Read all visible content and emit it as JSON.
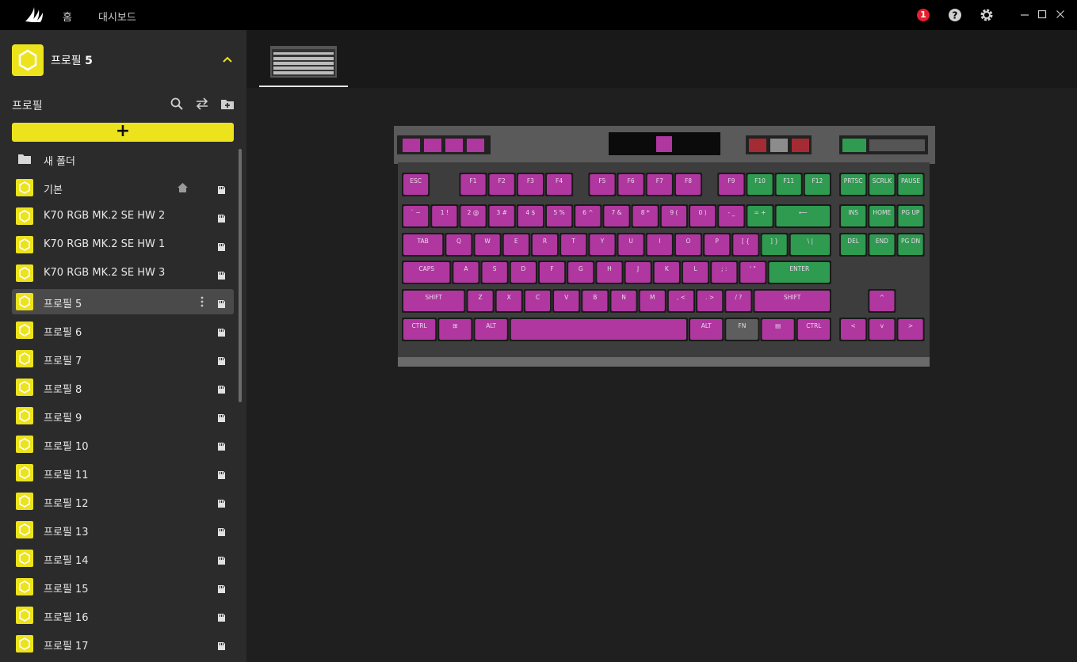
{
  "topnav": {
    "home": "홈",
    "dashboard": "대시보드"
  },
  "notifications": {
    "count": "1"
  },
  "icons": {
    "logo": "corsair-sails-logo",
    "help": "help-icon",
    "settings": "gear-icon",
    "minimize": "minimize-icon",
    "maximize": "maximize-icon",
    "close": "close-icon",
    "search": "search-icon",
    "swap": "swap-icon",
    "add_folder": "add-folder-icon",
    "memory": "onboard-memory-icon",
    "home": "home-icon"
  },
  "colors": {
    "accent": "#ece31c",
    "notification": "#e5202e",
    "key_magenta": "#b0379f",
    "key_green": "#2e9b50"
  },
  "selected_profile": {
    "prefix": "프로필",
    "number": "5"
  },
  "profiles_section": {
    "title": "프로필",
    "add_label": "+"
  },
  "profile_list": [
    {
      "label": "새 폴더",
      "type": "folder"
    },
    {
      "label": "기본",
      "type": "default"
    },
    {
      "label": "K70 RGB MK.2 SE HW 2",
      "type": "profile"
    },
    {
      "label": "K70 RGB MK.2 SE HW 1",
      "type": "profile"
    },
    {
      "label": "K70 RGB MK.2 SE HW 3",
      "type": "profile"
    },
    {
      "label": "프로필 5",
      "type": "profile",
      "active": true
    },
    {
      "label": "프로필 6",
      "type": "profile"
    },
    {
      "label": "프로필 7",
      "type": "profile"
    },
    {
      "label": "프로필 8",
      "type": "profile"
    },
    {
      "label": "프로필 9",
      "type": "profile"
    },
    {
      "label": "프로필 10",
      "type": "profile"
    },
    {
      "label": "프로필 11",
      "type": "profile"
    },
    {
      "label": "프로필 12",
      "type": "profile"
    },
    {
      "label": "프로필 13",
      "type": "profile"
    },
    {
      "label": "프로필 14",
      "type": "profile"
    },
    {
      "label": "프로필 15",
      "type": "profile"
    },
    {
      "label": "프로필 16",
      "type": "profile"
    },
    {
      "label": "프로필 17",
      "type": "profile"
    }
  ],
  "keyboard": {
    "rows": [
      [
        [
          "ESC",
          "m"
        ],
        [
          "F1",
          "m"
        ],
        [
          "F2",
          "m"
        ],
        [
          "F3",
          "m"
        ],
        [
          "F4",
          "m"
        ],
        [
          "F5",
          "m"
        ],
        [
          "F6",
          "m"
        ],
        [
          "F7",
          "m"
        ],
        [
          "F8",
          "m"
        ],
        [
          "F9",
          "m"
        ],
        [
          "F10",
          "g"
        ],
        [
          "F11",
          "g"
        ],
        [
          "F12",
          "g"
        ],
        [
          "PRTSC",
          "g"
        ],
        [
          "SCRLK",
          "g"
        ],
        [
          "PAUSE",
          "g"
        ]
      ],
      [
        [
          "` ~",
          "m"
        ],
        [
          "1 !",
          "m"
        ],
        [
          "2 @",
          "m"
        ],
        [
          "3 #",
          "m"
        ],
        [
          "4 $",
          "m"
        ],
        [
          "5 %",
          "m"
        ],
        [
          "6 ^",
          "m"
        ],
        [
          "7 &",
          "m"
        ],
        [
          "8 *",
          "m"
        ],
        [
          "9 (",
          "m"
        ],
        [
          "0 )",
          "m"
        ],
        [
          "- _",
          "m"
        ],
        [
          "= +",
          "g"
        ],
        [
          "⟵",
          "g"
        ],
        [
          "INS",
          "g"
        ],
        [
          "HOME",
          "g"
        ],
        [
          "PG UP",
          "g"
        ]
      ],
      [
        [
          "TAB",
          "m"
        ],
        [
          "Q",
          "m"
        ],
        [
          "W",
          "m"
        ],
        [
          "E",
          "m"
        ],
        [
          "R",
          "m"
        ],
        [
          "T",
          "m"
        ],
        [
          "Y",
          "m"
        ],
        [
          "U",
          "m"
        ],
        [
          "I",
          "m"
        ],
        [
          "O",
          "m"
        ],
        [
          "P",
          "m"
        ],
        [
          "[ {",
          "m"
        ],
        [
          "] }",
          "g"
        ],
        [
          "\\ |",
          "g"
        ],
        [
          "DEL",
          "g"
        ],
        [
          "END",
          "g"
        ],
        [
          "PG DN",
          "g"
        ]
      ],
      [
        [
          "CAPS",
          "m"
        ],
        [
          "A",
          "m"
        ],
        [
          "S",
          "m"
        ],
        [
          "D",
          "m"
        ],
        [
          "F",
          "m"
        ],
        [
          "G",
          "m"
        ],
        [
          "H",
          "m"
        ],
        [
          "J",
          "m"
        ],
        [
          "K",
          "m"
        ],
        [
          "L",
          "m"
        ],
        [
          "; :",
          "m"
        ],
        [
          "' \"",
          "m"
        ],
        [
          "ENTER",
          "g"
        ]
      ],
      [
        [
          "SHIFT",
          "m"
        ],
        [
          "Z",
          "m"
        ],
        [
          "X",
          "m"
        ],
        [
          "C",
          "m"
        ],
        [
          "V",
          "m"
        ],
        [
          "B",
          "m"
        ],
        [
          "N",
          "m"
        ],
        [
          "M",
          "m"
        ],
        [
          ", <",
          "m"
        ],
        [
          ". >",
          "m"
        ],
        [
          "/ ?",
          "m"
        ],
        [
          "SHIFT",
          "m"
        ],
        [
          "^",
          "m"
        ]
      ],
      [
        [
          "CTRL",
          "m"
        ],
        [
          "⊞",
          "m"
        ],
        [
          "ALT",
          "m"
        ],
        [
          "",
          "m"
        ],
        [
          "ALT",
          "m"
        ],
        [
          "FN",
          "x"
        ],
        [
          "▤",
          "m"
        ],
        [
          "CTRL",
          "m"
        ],
        [
          "<",
          "m"
        ],
        [
          "v",
          "m"
        ],
        [
          ">",
          "m"
        ]
      ]
    ]
  }
}
